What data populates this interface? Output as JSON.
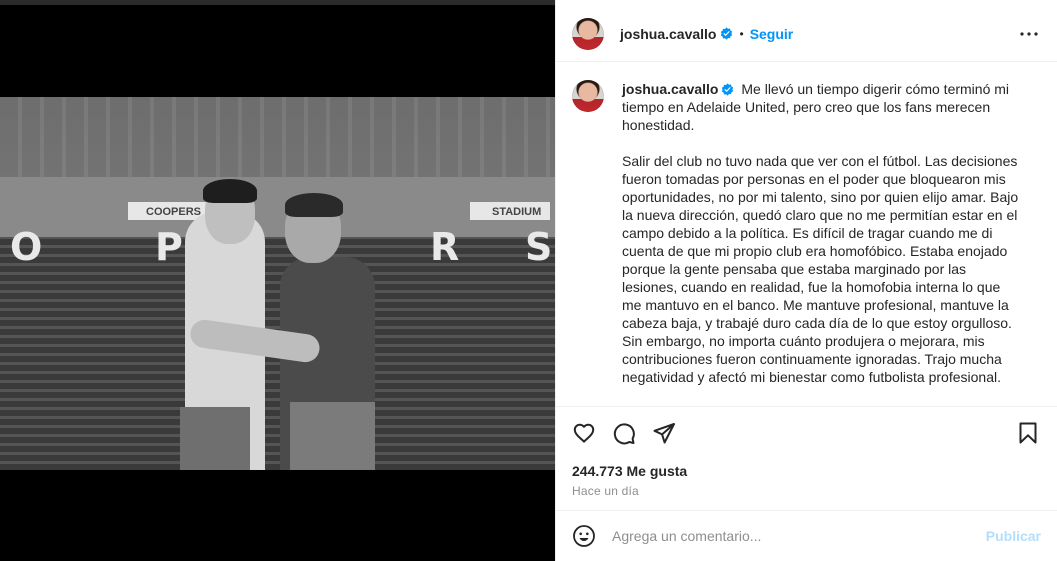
{
  "post": {
    "username": "joshua.cavallo",
    "follow_label": "Seguir",
    "separator": "•",
    "caption_p1": "Me llevó un tiempo digerir cómo terminó mi tiempo en Adelaide United, pero creo que los fans merecen honestidad.",
    "caption_p2": "Salir del club no tuvo nada que ver con el fútbol. Las decisiones fueron tomadas por personas en el poder que bloquearon mis oportunidades, no por mi talento, sino por quien elijo amar. Bajo la nueva dirección, quedó claro que no me permitían estar en el campo debido a la política. Es difícil de tragar cuando me di cuenta de que mi propio club era homofóbico. Estaba enojado porque la gente pensaba que estaba marginado por las lesiones, cuando en realidad, fue la homofobia interna lo que me mantuvo en el banco. Me mantuve profesional, mantuve la cabeza baja, y trabajé duro cada día de lo que estoy orgulloso. Sin embargo, no importa cuánto produjera o mejorara, mis contribuciones fueron continuamente ignoradas. Trajo mucha negatividad y afectó mi bienestar como futbolista profesional.",
    "likes": "244.773 Me gusta",
    "time": "Hace un día"
  },
  "photo": {
    "banner_text": "COOPERS",
    "stadium_text": "STADIUM",
    "seat_letters": [
      "O",
      "P",
      "R",
      "S"
    ]
  },
  "comment": {
    "placeholder": "Agrega un comentario...",
    "post_label": "Publicar"
  },
  "icons": {
    "verified": "verified-badge-icon",
    "more": "more-options-icon",
    "like": "heart-icon",
    "comment": "comment-bubble-icon",
    "share": "paper-plane-icon",
    "save": "bookmark-icon",
    "emoji": "emoji-smiley-icon"
  },
  "colors": {
    "accent": "#0095f6",
    "verified": "#0095f6",
    "post_disabled": "#b2dffc",
    "muted": "#8e8e8e",
    "text": "#262626"
  }
}
